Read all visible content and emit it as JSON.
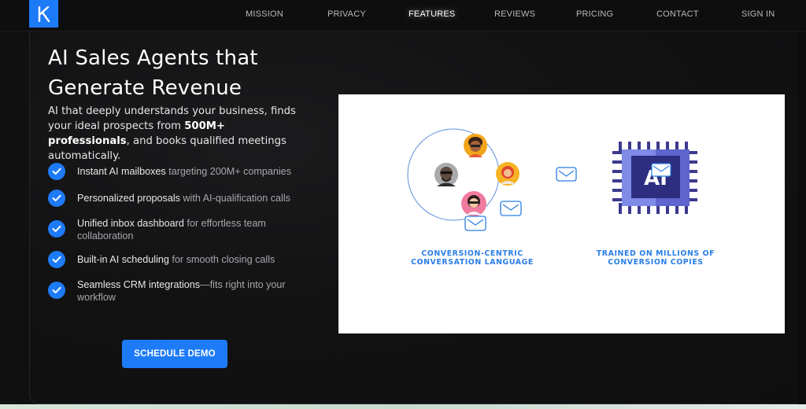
{
  "brand": {
    "logo_letter": "K",
    "accent": "#1e7bf7"
  },
  "nav": {
    "items": [
      {
        "label": "MISSION",
        "active": false
      },
      {
        "label": "PRIVACY",
        "active": false
      },
      {
        "label": "FEATURES",
        "active": true
      },
      {
        "label": "REVIEWS",
        "active": false
      },
      {
        "label": "PRICING",
        "active": false
      },
      {
        "label": "CONTACT",
        "active": false
      },
      {
        "label": "SIGN IN",
        "active": false
      }
    ]
  },
  "hero": {
    "title_line1": "AI Sales Agents that",
    "title_line2": "Generate Revenue",
    "subtitle_part1": "AI that deeply understands your business, finds your ideal prospects from ",
    "subtitle_bold": "500M+ professionals",
    "subtitle_part2": ", and books qualified meetings automatically.",
    "features": [
      {
        "highlight": "Instant AI mailboxes",
        "rest": " targeting 200M+ companies"
      },
      {
        "highlight": "Personalized proposals",
        "rest": " with AI-qualification calls"
      },
      {
        "highlight": "Unified inbox dashboard",
        "rest": " for effortless team collaboration"
      },
      {
        "highlight": "Built-in AI scheduling",
        "rest": " for smooth closing calls"
      },
      {
        "highlight": "Seamless CRM integrations",
        "rest": "—fits right into your workflow"
      }
    ],
    "cta_label": "SCHEDULE DEMO"
  },
  "illustration": {
    "left_caption_line1": "CONVERSION-CENTRIC",
    "left_caption_line2": "CONVERSATION LANGUAGE",
    "right_caption_line1": "TRAINED ON MILLIONS OF",
    "right_caption_line2": "CONVERSION COPIES",
    "chip_label": "AI",
    "icons": [
      "avatar-icon",
      "mail-icon",
      "ai-chip-icon"
    ]
  }
}
